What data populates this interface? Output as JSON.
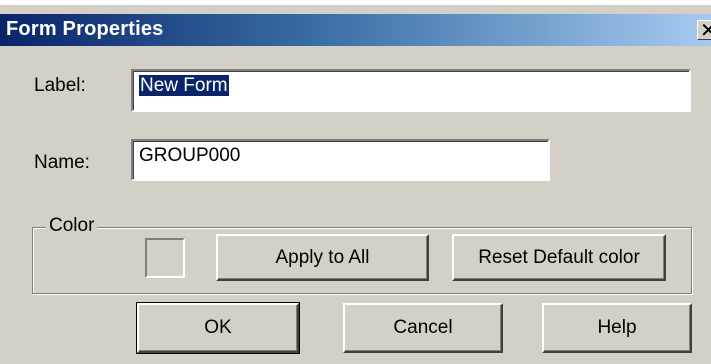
{
  "window": {
    "title": "Form Properties",
    "close_glyph": "✕"
  },
  "fields": {
    "label_caption": "Label:",
    "label_value": "New Form",
    "name_caption": "Name:",
    "name_value": "GROUP000"
  },
  "color_group": {
    "legend": "Color",
    "apply_all_label": "Apply to All",
    "reset_label": "Reset Default color"
  },
  "buttons": {
    "ok_label": "OK",
    "cancel_label": "Cancel",
    "help_label": "Help"
  },
  "colors": {
    "dialog_bg": "#d4d0c8",
    "title_start": "#0a246a",
    "title_end": "#a6caf0",
    "selection": "#0a246a"
  }
}
